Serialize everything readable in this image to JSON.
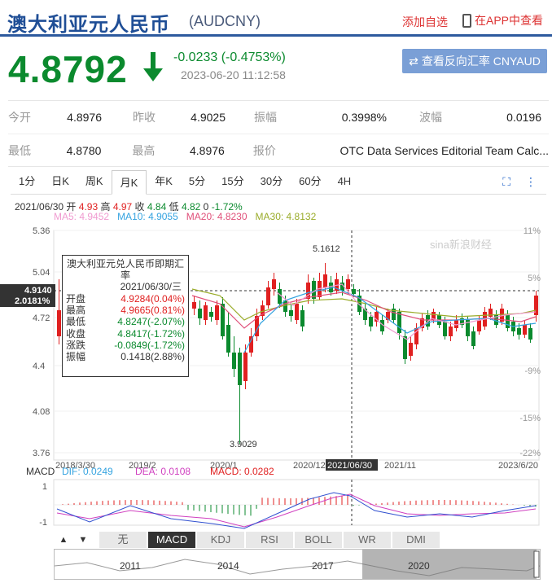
{
  "header": {
    "title": "澳大利亚元人民币",
    "code": "(AUDCNY)",
    "add_fav": "添加自选",
    "app_view": "在APP中查看"
  },
  "quote": {
    "price": "4.8792",
    "change": "-0.0233 (-0.4753%)",
    "datetime": "2023-06-20 11:12:58",
    "reverse_btn": "查看反向汇率 CNYAUD"
  },
  "stats": {
    "row1": [
      {
        "label": "今开",
        "value": "4.8976"
      },
      {
        "label": "昨收",
        "value": "4.9025"
      },
      {
        "label": "振幅",
        "value": "0.3998%"
      },
      {
        "label": "波幅",
        "value": "0.0196"
      }
    ],
    "row2": [
      {
        "label": "最低",
        "value": "4.8780"
      },
      {
        "label": "最高",
        "value": "4.8976"
      },
      {
        "label": "报价",
        "value": "OTC Data Services Editorial Team Calc..."
      }
    ]
  },
  "kline_tabs": [
    "1分",
    "日K",
    "周K",
    "月K",
    "年K",
    "5分",
    "15分",
    "30分",
    "60分",
    "4H"
  ],
  "active_tab": "月K",
  "info": {
    "date": "2021/06/30",
    "open_l": "开",
    "open": "4.93",
    "high_l": "高",
    "high": "4.97",
    "close_l": "收",
    "close": "4.84",
    "low_l": "低",
    "low": "4.82",
    "vol_l": "0",
    "pct": "-1.72%",
    "ma5": "MA5: 4.9452",
    "ma10": "MA10: 4.9055",
    "ma20": "MA20: 4.8230",
    "ma30": "MA30: 4.8132"
  },
  "tooltip": {
    "title": "澳大利亚元兑人民币即期汇率",
    "date": "2021/06/30/三",
    "rows": [
      {
        "label": "开盘",
        "value": "4.9284(0.04%)",
        "color": "#e02020"
      },
      {
        "label": "最高",
        "value": "4.9665(0.81%)",
        "color": "#e02020"
      },
      {
        "label": "最低",
        "value": "4.8247(-2.07%)",
        "color": "#0b8a2e"
      },
      {
        "label": "收盘",
        "value": "4.8417(-1.72%)",
        "color": "#0b8a2e"
      },
      {
        "label": "涨跌",
        "value": "-0.0849(-1.72%)",
        "color": "#0b8a2e"
      },
      {
        "label": "振幅",
        "value": "0.1418(2.88%)",
        "color": "#333"
      }
    ]
  },
  "axis": {
    "y_left": [
      "5.36",
      "5.04",
      "4.72",
      "4.4",
      "4.08",
      "3.76"
    ],
    "y_right": [
      "11%",
      "5%",
      "-9%",
      "-15%",
      "-22%"
    ],
    "x": [
      "2018/3/30",
      "2019/2",
      "2020/1",
      "2020/12",
      "2021/11",
      "2023/6/20"
    ],
    "cursor_date": "2021/06/30",
    "cursor_price": "4.9140",
    "cursor_pct": "2.0181%",
    "max_label": "5.1612",
    "min_label": "3.9029",
    "watermark": "sina新浪财经"
  },
  "macd": {
    "label": "MACD",
    "dif": "DIF: 0.0249",
    "dea": "DEA: 0.0108",
    "macd": "MACD: 0.0282",
    "y1": "1",
    "y2": "-1"
  },
  "bottom_tabs": [
    "无",
    "MACD",
    "KDJ",
    "RSI",
    "BOLL",
    "WR",
    "DMI"
  ],
  "bottom_active": "MACD",
  "overview_years": [
    "2011",
    "2014",
    "2017",
    "2020"
  ],
  "colors": {
    "up": "#e02020",
    "down": "#0b8a2e",
    "ma5": "#f09ad0",
    "ma10": "#34a3e0",
    "ma20": "#e0507a",
    "ma30": "#9aac2a"
  }
}
